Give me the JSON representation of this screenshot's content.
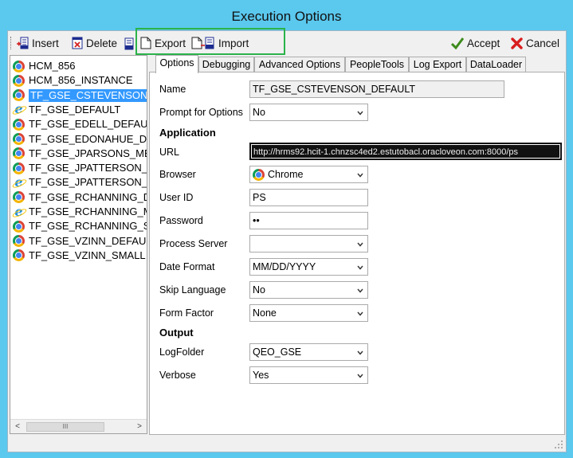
{
  "window": {
    "title": "Execution Options"
  },
  "toolbar": {
    "insert_label": "Insert",
    "delete_label": "Delete",
    "export_label": "Export",
    "import_label": "Import",
    "accept_label": "Accept",
    "cancel_label": "Cancel",
    "highlight_color": "#2bb34a"
  },
  "tree": {
    "items": [
      {
        "label": "HCM_856",
        "icon": "chrome-icon"
      },
      {
        "label": "HCM_856_INSTANCE",
        "icon": "chrome-icon"
      },
      {
        "label": "TF_GSE_CSTEVENSON_",
        "icon": "chrome-icon",
        "selected": true
      },
      {
        "label": "TF_GSE_DEFAULT",
        "icon": "ie-icon"
      },
      {
        "label": "TF_GSE_EDELL_DEFAU",
        "icon": "chrome-icon"
      },
      {
        "label": "TF_GSE_EDONAHUE_D",
        "icon": "chrome-icon"
      },
      {
        "label": "TF_GSE_JPARSONS_ME",
        "icon": "chrome-icon"
      },
      {
        "label": "TF_GSE_JPATTERSON_",
        "icon": "chrome-icon"
      },
      {
        "label": "TF_GSE_JPATTERSON_",
        "icon": "ie-icon"
      },
      {
        "label": "TF_GSE_RCHANNING_D",
        "icon": "chrome-icon"
      },
      {
        "label": "TF_GSE_RCHANNING_M",
        "icon": "ie-icon"
      },
      {
        "label": "TF_GSE_RCHANNING_S",
        "icon": "chrome-icon"
      },
      {
        "label": "TF_GSE_VZINN_DEFAU",
        "icon": "chrome-icon"
      },
      {
        "label": "TF_GSE_VZINN_SMALL",
        "icon": "chrome-icon"
      }
    ],
    "scroll_left": "<",
    "scroll_thumb": "III",
    "scroll_right": ">"
  },
  "tabs": [
    {
      "label": "Options",
      "active": true
    },
    {
      "label": "Debugging"
    },
    {
      "label": "Advanced Options"
    },
    {
      "label": "PeopleTools"
    },
    {
      "label": "Log Export"
    },
    {
      "label": "DataLoader"
    }
  ],
  "form": {
    "name_label": "Name",
    "name_value": "TF_GSE_CSTEVENSON_DEFAULT",
    "prompt_label": "Prompt for Options",
    "prompt_value": "No",
    "application_heading": "Application",
    "url_label": "URL",
    "url_value": "http://hrms92.hcit-1.chnzsc4ed2.estutobacl.oracloveon.com:8000/ps",
    "browser_label": "Browser",
    "browser_value": "Chrome",
    "userid_label": "User ID",
    "userid_value": "PS",
    "password_label": "Password",
    "password_value": "••",
    "process_server_label": "Process Server",
    "process_server_value": "",
    "date_format_label": "Date Format",
    "date_format_value": "MM/DD/YYYY",
    "skip_language_label": "Skip Language",
    "skip_language_value": "No",
    "form_factor_label": "Form Factor",
    "form_factor_value": "None",
    "output_heading": "Output",
    "logfolder_label": "LogFolder",
    "logfolder_value": "QEO_GSE",
    "verbose_label": "Verbose",
    "verbose_value": "Yes"
  }
}
